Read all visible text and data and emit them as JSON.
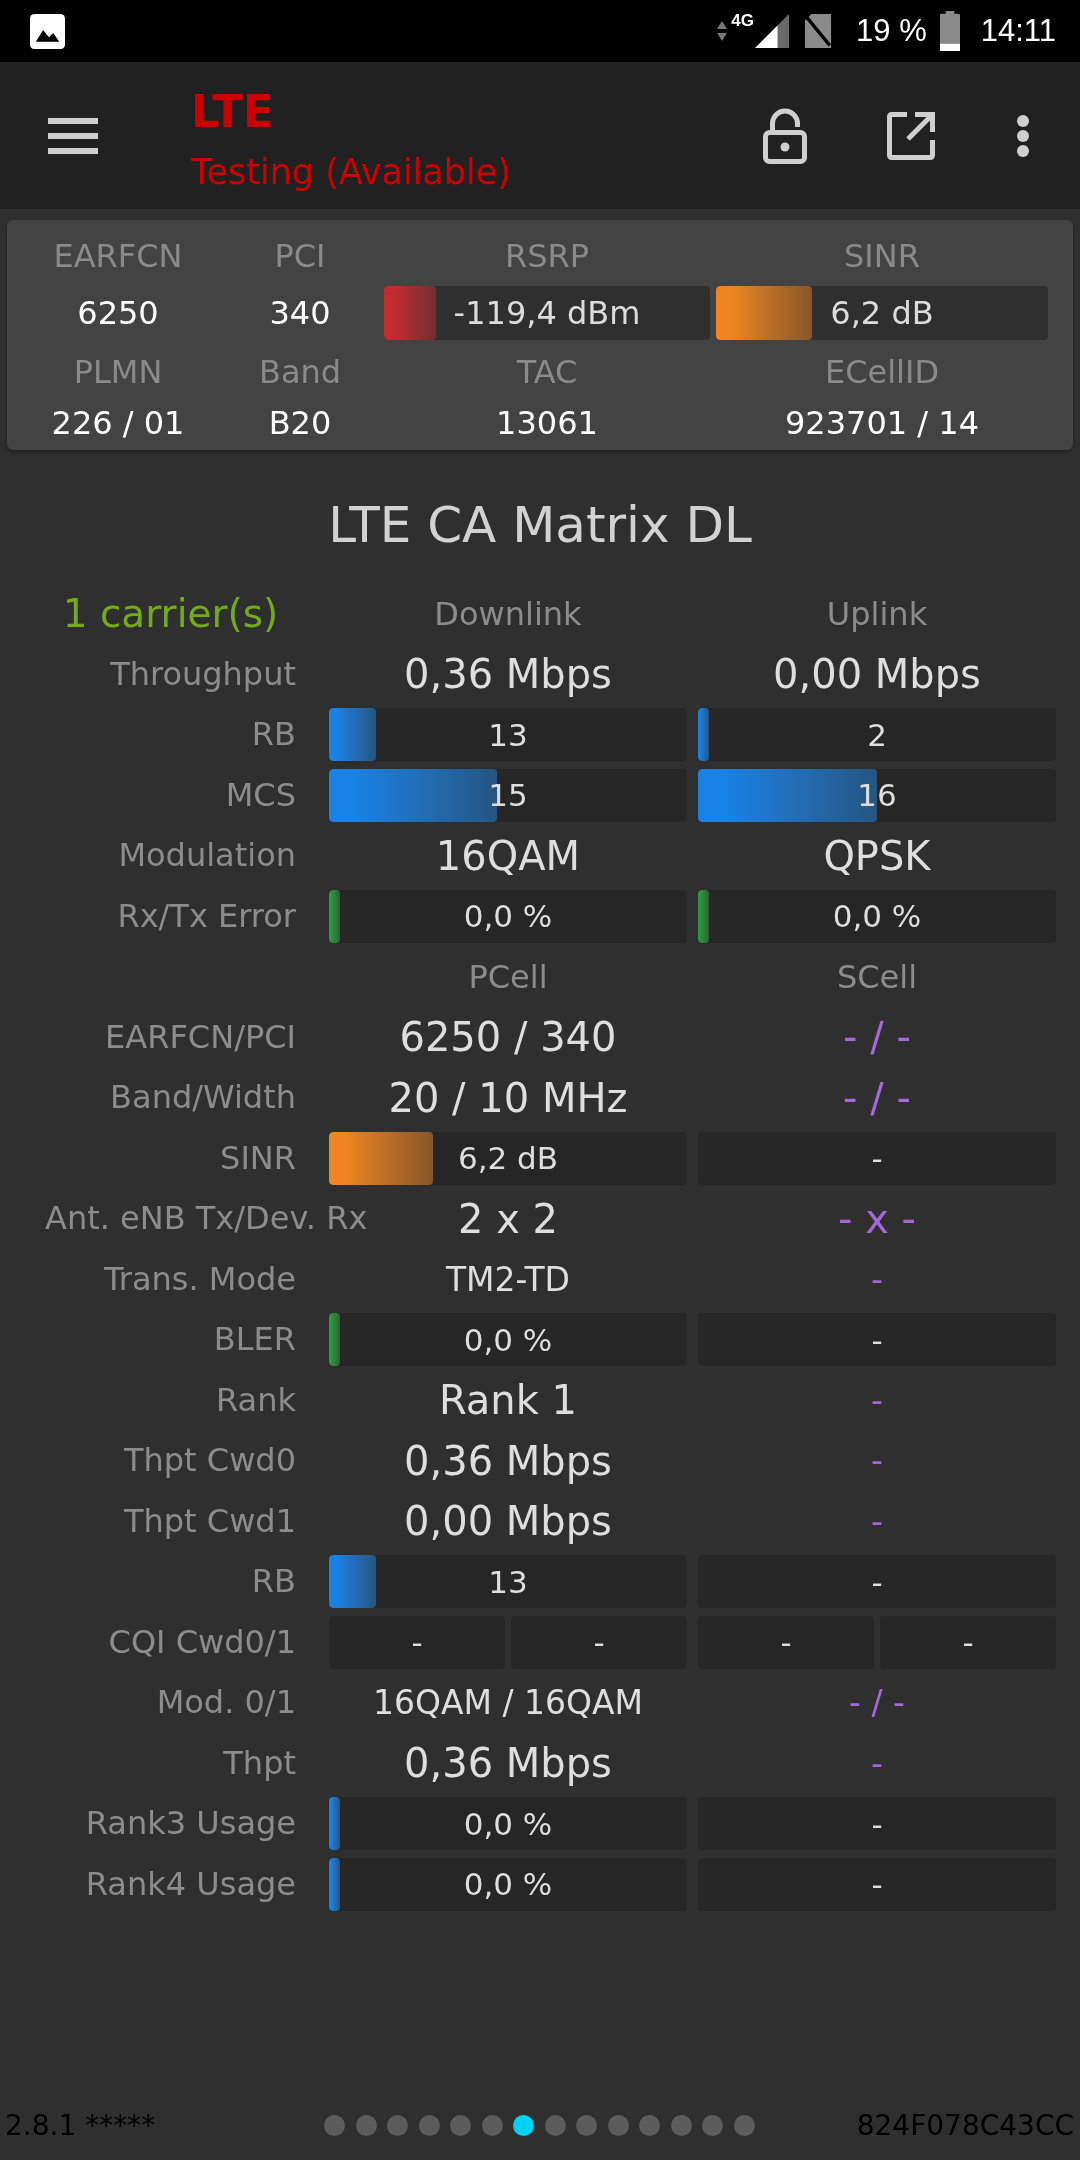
{
  "status_bar": {
    "network": "4G",
    "battery": "19 %",
    "time": "14:11"
  },
  "toolbar": {
    "title": "LTE",
    "subtitle": "Testing (Available)"
  },
  "cell_info": [
    {
      "label": "EARFCN",
      "kind": "text",
      "value": "6250"
    },
    {
      "label": "PCI",
      "kind": "text",
      "value": "340"
    },
    {
      "label": "RSRP",
      "kind": "bar",
      "value": "-119,4 dBm",
      "level": 0.16,
      "color": "#c62a2e"
    },
    {
      "label": "SINR",
      "kind": "bar",
      "value": "6,2 dB",
      "level": 0.29,
      "color": "#f0851f"
    },
    {
      "label": "PLMN",
      "kind": "text",
      "value": "226 / 01"
    },
    {
      "label": "Band",
      "kind": "text",
      "value": "B20"
    },
    {
      "label": "TAC",
      "kind": "text",
      "value": "13061"
    },
    {
      "label": "ECellID",
      "kind": "text",
      "value": "923701 / 14"
    }
  ],
  "matrix": {
    "title": "LTE CA Matrix DL",
    "rows": [
      {
        "kind": "header",
        "label": "1 carrier(s)",
        "cells": [
          {
            "kind": "heading",
            "text": "Downlink"
          },
          {
            "kind": "heading",
            "text": "Uplink"
          }
        ]
      },
      {
        "kind": "data",
        "label": "Throughput",
        "cells": [
          {
            "kind": "large",
            "text": "0,36 Mbps",
            "available": true
          },
          {
            "kind": "large",
            "text": "0,00 Mbps",
            "available": true
          }
        ]
      },
      {
        "kind": "data",
        "label": "RB",
        "cells": [
          {
            "kind": "bar",
            "text": "13",
            "level": 0.13,
            "color": "#1882e6"
          },
          {
            "kind": "bar",
            "text": "2",
            "level": 0.03,
            "color": "#1882e6"
          }
        ]
      },
      {
        "kind": "data",
        "label": "MCS",
        "cells": [
          {
            "kind": "bar",
            "text": "15",
            "level": 0.47,
            "color": "#1882e6"
          },
          {
            "kind": "bar",
            "text": "16",
            "level": 0.5,
            "color": "#1882e6"
          }
        ]
      },
      {
        "kind": "data",
        "label": "Modulation",
        "cells": [
          {
            "kind": "large",
            "text": "16QAM",
            "available": true
          },
          {
            "kind": "large",
            "text": "QPSK",
            "available": true
          }
        ]
      },
      {
        "kind": "data",
        "label": "Rx/Tx Error",
        "cells": [
          {
            "kind": "bar",
            "text": "0,0 %",
            "level": 0.03,
            "color": "#2a9a3e"
          },
          {
            "kind": "bar",
            "text": "0,0 %",
            "level": 0.03,
            "color": "#2a9a3e"
          }
        ]
      },
      {
        "kind": "header",
        "cells": [
          {
            "kind": "heading",
            "text": "PCell"
          },
          {
            "kind": "heading",
            "text": "SCell"
          }
        ]
      },
      {
        "kind": "data",
        "label": "EARFCN/PCI",
        "cells": [
          {
            "kind": "large",
            "text": "6250 / 340",
            "available": true
          },
          {
            "kind": "large",
            "text": "- / -",
            "available": false
          }
        ]
      },
      {
        "kind": "data",
        "label": "Band/Width",
        "cells": [
          {
            "kind": "large",
            "text": "20 / 10 MHz",
            "available": true
          },
          {
            "kind": "large",
            "text": "- / -",
            "available": false
          }
        ]
      },
      {
        "kind": "data",
        "label": "SINR",
        "cells": [
          {
            "kind": "bar",
            "text": "6,2 dB",
            "level": 0.29,
            "color": "#f0851f"
          },
          {
            "kind": "track",
            "text": "-"
          }
        ]
      },
      {
        "kind": "data",
        "label": "Ant. eNB Tx/Dev. Rx",
        "cells": [
          {
            "kind": "large",
            "text": "2 x 2",
            "available": true
          },
          {
            "kind": "large",
            "text": "- x -",
            "available": false
          }
        ]
      },
      {
        "kind": "data",
        "label": "Trans. Mode",
        "cells": [
          {
            "kind": "medium",
            "text": "TM2-TD",
            "available": true
          },
          {
            "kind": "medium",
            "text": "-",
            "available": false
          }
        ]
      },
      {
        "kind": "data",
        "label": "BLER",
        "cells": [
          {
            "kind": "bar",
            "text": "0,0 %",
            "level": 0.03,
            "color": "#2a9a3e"
          },
          {
            "kind": "track",
            "text": "-"
          }
        ]
      },
      {
        "kind": "data",
        "label": "Rank",
        "cells": [
          {
            "kind": "large",
            "text": "Rank 1",
            "available": true
          },
          {
            "kind": "medium",
            "text": "-",
            "available": false
          }
        ]
      },
      {
        "kind": "data",
        "label": "Thpt Cwd0",
        "cells": [
          {
            "kind": "large",
            "text": "0,36 Mbps",
            "available": true
          },
          {
            "kind": "medium",
            "text": "-",
            "available": false
          }
        ]
      },
      {
        "kind": "data",
        "label": "Thpt Cwd1",
        "cells": [
          {
            "kind": "large",
            "text": "0,00 Mbps",
            "available": true
          },
          {
            "kind": "medium",
            "text": "-",
            "available": false
          }
        ]
      },
      {
        "kind": "data",
        "label": "RB",
        "cells": [
          {
            "kind": "bar",
            "text": "13",
            "level": 0.13,
            "color": "#1882e6"
          },
          {
            "kind": "track",
            "text": "-"
          }
        ]
      },
      {
        "kind": "data",
        "label": "CQI Cwd0/1",
        "cells": [
          {
            "kind": "pair",
            "texts": [
              "-",
              "-"
            ]
          },
          {
            "kind": "pair",
            "texts": [
              "-",
              "-"
            ]
          }
        ]
      },
      {
        "kind": "data",
        "label": "Mod. 0/1",
        "cells": [
          {
            "kind": "medium",
            "text": "16QAM / 16QAM",
            "available": true
          },
          {
            "kind": "medium",
            "text": "- / -",
            "available": false
          }
        ]
      },
      {
        "kind": "data",
        "label": "Thpt",
        "cells": [
          {
            "kind": "large",
            "text": "0,36 Mbps",
            "available": true
          },
          {
            "kind": "medium",
            "text": "-",
            "available": false
          }
        ]
      },
      {
        "kind": "data",
        "label": "Rank3 Usage",
        "cells": [
          {
            "kind": "bar",
            "text": "0,0 %",
            "level": 0.03,
            "color": "#1882e6"
          },
          {
            "kind": "track",
            "text": "-"
          }
        ]
      },
      {
        "kind": "data",
        "label": "Rank4 Usage",
        "cells": [
          {
            "kind": "bar",
            "text": "0,0 %",
            "level": 0.03,
            "color": "#1882e6"
          },
          {
            "kind": "track",
            "text": "-"
          }
        ]
      }
    ]
  },
  "footer": {
    "version": "2.8.1 *****",
    "pages": [
      {
        "selected": false
      },
      {
        "selected": false
      },
      {
        "selected": false
      },
      {
        "selected": false
      },
      {
        "selected": false
      },
      {
        "selected": false
      },
      {
        "selected": true
      },
      {
        "selected": false
      },
      {
        "selected": false
      },
      {
        "selected": false
      },
      {
        "selected": false
      },
      {
        "selected": false
      },
      {
        "selected": false
      },
      {
        "selected": false
      }
    ],
    "device_id": "824F078C43CC"
  }
}
